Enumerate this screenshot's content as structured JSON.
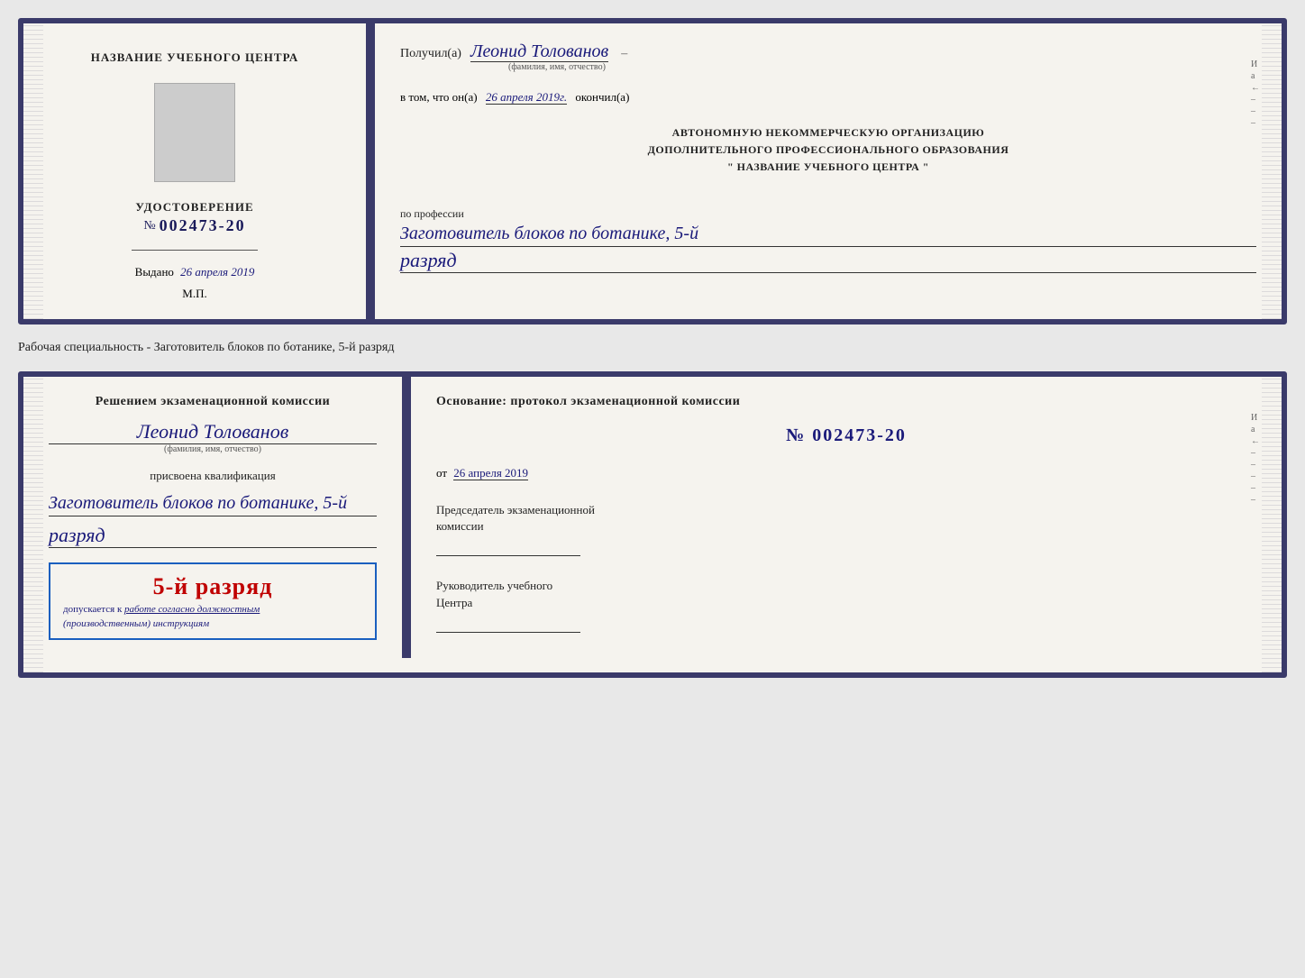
{
  "card1": {
    "left": {
      "training_center_label": "НАЗВАНИЕ УЧЕБНОГО ЦЕНТРА",
      "cert_title": "УДОСТОВЕРЕНИЕ",
      "cert_number_prefix": "№",
      "cert_number": "002473-20",
      "issued_label": "Выдано",
      "issued_date": "26 апреля 2019",
      "mp_label": "М.П."
    },
    "right": {
      "recipient_prefix": "Получил(а)",
      "recipient_name": "Леонид Толованов",
      "recipient_sub": "(фамилия, имя, отчество)",
      "confirm_text": "в том, что он(а)",
      "confirm_date": "26 апреля 2019г.",
      "confirm_suffix": "окончил(а)",
      "org_line1": "АВТОНОМНУЮ НЕКОММЕРЧЕСКУЮ ОРГАНИЗАЦИЮ",
      "org_line2": "ДОПОЛНИТЕЛЬНОГО ПРОФЕССИОНАЛЬНОГО ОБРАЗОВАНИЯ",
      "org_line3": "\" НАЗВАНИЕ УЧЕБНОГО ЦЕНТРА \"",
      "profession_label": "по профессии",
      "profession_value": "Заготовитель блоков по ботанике, 5-й",
      "razryad_value": "разряд"
    }
  },
  "specialty_label": "Рабочая специальность - Заготовитель блоков по ботанике, 5-й разряд",
  "card2": {
    "left": {
      "decision_text": "Решением экзаменационной комиссии",
      "person_name": "Леонид Толованов",
      "person_sub": "(фамилия, имя, отчество)",
      "qualification_label": "присвоена квалификация",
      "qualification_value": "Заготовитель блоков по ботанике, 5-й",
      "razryad_value": "разряд",
      "stamp_rank": "5-й разряд",
      "stamp_allows": "допускается к",
      "stamp_work": "работе согласно должностным",
      "stamp_instructions": "(производственным) инструкциям"
    },
    "right": {
      "basis_text": "Основание: протокол экзаменационной комиссии",
      "protocol_number": "№ 002473-20",
      "from_prefix": "от",
      "from_date": "26 апреля 2019",
      "chairman_label": "Председатель экзаменационной",
      "chairman_label2": "комиссии",
      "head_label": "Руководитель учебного",
      "head_label2": "Центра"
    }
  },
  "side_chars_1": [
    "И",
    "а",
    "←",
    "–",
    "–",
    "–"
  ],
  "side_chars_2": [
    "И",
    "а",
    "←",
    "–",
    "–",
    "–",
    "–",
    "–"
  ]
}
